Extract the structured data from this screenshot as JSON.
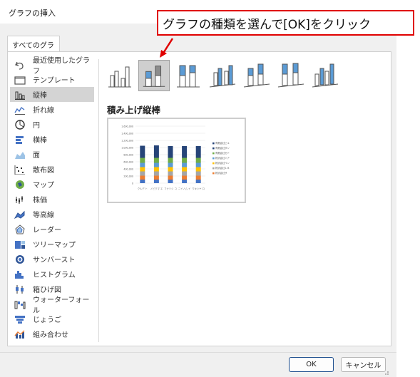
{
  "window": {
    "title": "グラフの挿入"
  },
  "callout": {
    "text": "グラフの種類を選んで[OK]をクリック"
  },
  "tab": {
    "label": "すべてのグラフ"
  },
  "sidebar": {
    "items": [
      {
        "label": "最近使用したグラフ",
        "icon": "undo-icon",
        "selected": false
      },
      {
        "label": "テンプレート",
        "icon": "folder-icon",
        "selected": false
      },
      {
        "label": "縦棒",
        "icon": "column-chart-icon",
        "selected": true
      },
      {
        "label": "折れ線",
        "icon": "line-chart-icon",
        "selected": false
      },
      {
        "label": "円",
        "icon": "pie-chart-icon",
        "selected": false
      },
      {
        "label": "横棒",
        "icon": "bar-chart-icon",
        "selected": false
      },
      {
        "label": "面",
        "icon": "area-chart-icon",
        "selected": false
      },
      {
        "label": "散布図",
        "icon": "scatter-chart-icon",
        "selected": false
      },
      {
        "label": "マップ",
        "icon": "map-chart-icon",
        "selected": false
      },
      {
        "label": "株価",
        "icon": "stock-chart-icon",
        "selected": false
      },
      {
        "label": "等高線",
        "icon": "surface-chart-icon",
        "selected": false
      },
      {
        "label": "レーダー",
        "icon": "radar-chart-icon",
        "selected": false
      },
      {
        "label": "ツリーマップ",
        "icon": "treemap-chart-icon",
        "selected": false
      },
      {
        "label": "サンバースト",
        "icon": "sunburst-chart-icon",
        "selected": false
      },
      {
        "label": "ヒストグラム",
        "icon": "histogram-chart-icon",
        "selected": false
      },
      {
        "label": "箱ひげ図",
        "icon": "box-whisker-icon",
        "selected": false
      },
      {
        "label": "ウォーターフォール",
        "icon": "waterfall-chart-icon",
        "selected": false
      },
      {
        "label": "じょうご",
        "icon": "funnel-chart-icon",
        "selected": false
      },
      {
        "label": "組み合わせ",
        "icon": "combo-chart-icon",
        "selected": false
      }
    ]
  },
  "subtypes": {
    "selected_title": "積み上げ縦棒",
    "items": [
      {
        "icon": "clustered-column-icon",
        "selected": false
      },
      {
        "icon": "stacked-column-icon",
        "selected": true
      },
      {
        "icon": "100-stacked-column-icon",
        "selected": false
      },
      {
        "icon": "3d-clustered-column-icon",
        "selected": false
      },
      {
        "icon": "3d-stacked-column-icon",
        "selected": false
      },
      {
        "icon": "3d-100-stacked-column-icon",
        "selected": false
      },
      {
        "icon": "3d-column-icon",
        "selected": false
      }
    ]
  },
  "colors": {
    "accent": "#1e4f8f",
    "callout_border": "#e00000",
    "series": [
      "#4472c4",
      "#ed7d31",
      "#a5a5a5",
      "#ffc000",
      "#5b9bd5",
      "#70ad47",
      "#264478"
    ]
  },
  "chart_data": {
    "type": "bar",
    "stacked": true,
    "categories": [
      "クルデ ト",
      "ノビクマ エ",
      "フナソシ コ",
      "ニイノム イ",
      "ワキシヤ ロ"
    ],
    "series": [
      {
        "name": "",
        "values": [
          100000,
          100000,
          100000,
          100000,
          100000
        ]
      },
      {
        "name": "株式会社ザ",
        "values": [
          110000,
          110000,
          110000,
          110000,
          110000
        ]
      },
      {
        "name": "株式会社１Ｂ",
        "values": [
          120000,
          120000,
          120000,
          120000,
          120000
        ]
      },
      {
        "name": "株式会社ベン",
        "values": [
          120000,
          120000,
          120000,
          120000,
          120000
        ]
      },
      {
        "name": "株式会社ミア",
        "values": [
          120000,
          120000,
          120000,
          120000,
          120000
        ]
      },
      {
        "name": "有限会社セド",
        "values": [
          140000,
          140000,
          140000,
          140000,
          140000
        ]
      },
      {
        "name": "有限会社ダン",
        "values": [
          150000,
          150000,
          150000,
          150000,
          150000
        ]
      },
      {
        "name": "有限会社ビユ",
        "values": [
          190000,
          200000,
          180000,
          180000,
          180000
        ]
      }
    ],
    "y_ticks": [
      "1,600,000",
      "1,400,000",
      "1,200,000",
      "1,000,000",
      "800,000",
      "600,000",
      "400,000",
      "200,000",
      "0"
    ],
    "ylim": [
      0,
      1600000
    ],
    "grid": true,
    "legend": "right"
  },
  "buttons": {
    "ok": "OK",
    "cancel": "キャンセル"
  }
}
